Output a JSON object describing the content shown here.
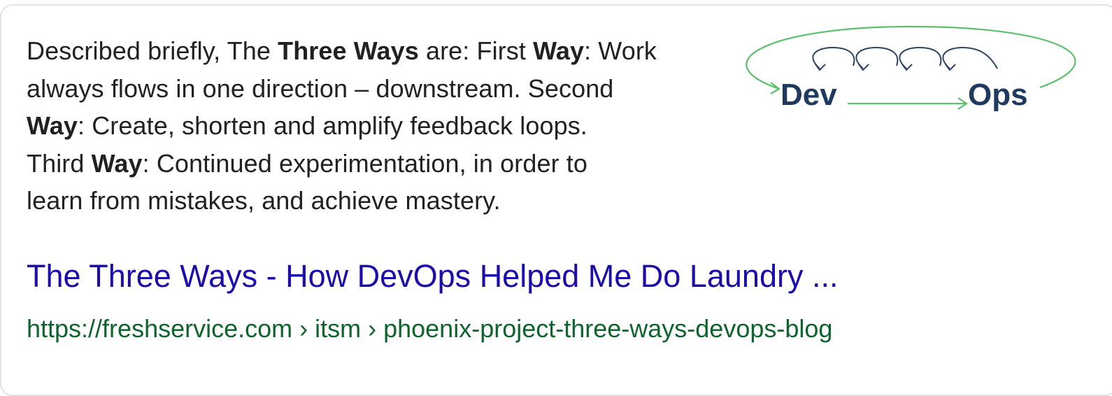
{
  "snippet": {
    "line1_a": "Described briefly, The ",
    "line1_b1": "Three Ways",
    "line1_c": " are: First ",
    "line1_b2": "Way",
    "line1_d": ": Work",
    "line2": "always flows in one direction – downstream. Second",
    "line3_b": "Way",
    "line3_a": ": Create, shorten and amplify feedback loops.",
    "line4_a": "Third ",
    "line4_b": "Way",
    "line4_c": ": Continued experimentation, in order to",
    "line5": "learn from mistakes, and achieve mastery."
  },
  "thumbnail": {
    "left_word": "Dev",
    "right_word": "Ops",
    "colors": {
      "loop": "#5cbf6e",
      "text": "#1f3a5f",
      "arrows": "#2e4460"
    }
  },
  "result": {
    "title": "The Three Ways - How DevOps Helped Me Do Laundry ...",
    "url": "https://freshservice.com › itsm › phoenix-project-three-ways-devops-blog"
  },
  "colors": {
    "title": "#1a0dab",
    "url": "#0d652d",
    "text": "#202124"
  }
}
